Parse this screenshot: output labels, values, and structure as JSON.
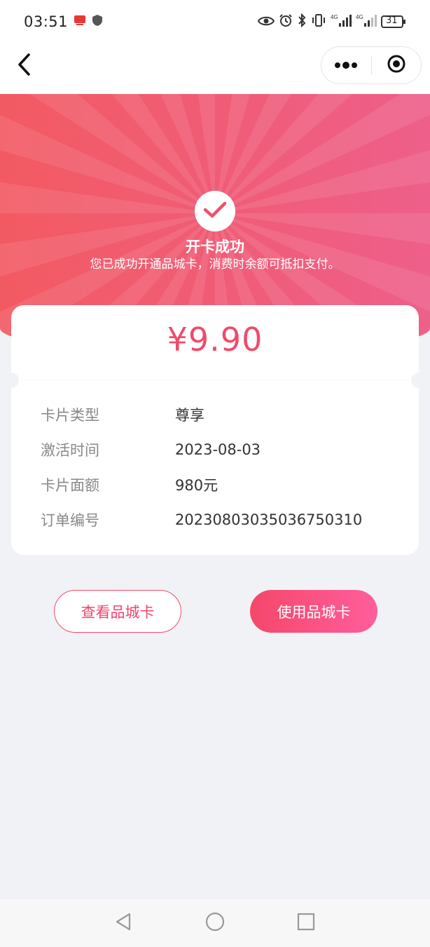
{
  "status_bar": {
    "time": "03:51",
    "battery": "31"
  },
  "hero": {
    "title": "开卡成功",
    "subtitle": "您已成功开通品城卡，消费时余额可抵扣支付。"
  },
  "card": {
    "amount": "¥9.90",
    "rows": [
      {
        "label": "卡片类型",
        "value": "尊享"
      },
      {
        "label": "激活时间",
        "value": "2023-08-03"
      },
      {
        "label": "卡片面额",
        "value": "980元"
      },
      {
        "label": "订单编号",
        "value": "20230803035036750310"
      }
    ]
  },
  "buttons": {
    "view_card": "查看品城卡",
    "use_card": "使用品城卡"
  },
  "colors": {
    "accent": "#f04b6a",
    "hero_start": "#f25a62",
    "hero_end": "#ee5f8a"
  },
  "icons": {
    "back": "chevron-left-icon",
    "more": "more-dots-icon",
    "close": "target-close-icon",
    "success": "check-icon"
  }
}
